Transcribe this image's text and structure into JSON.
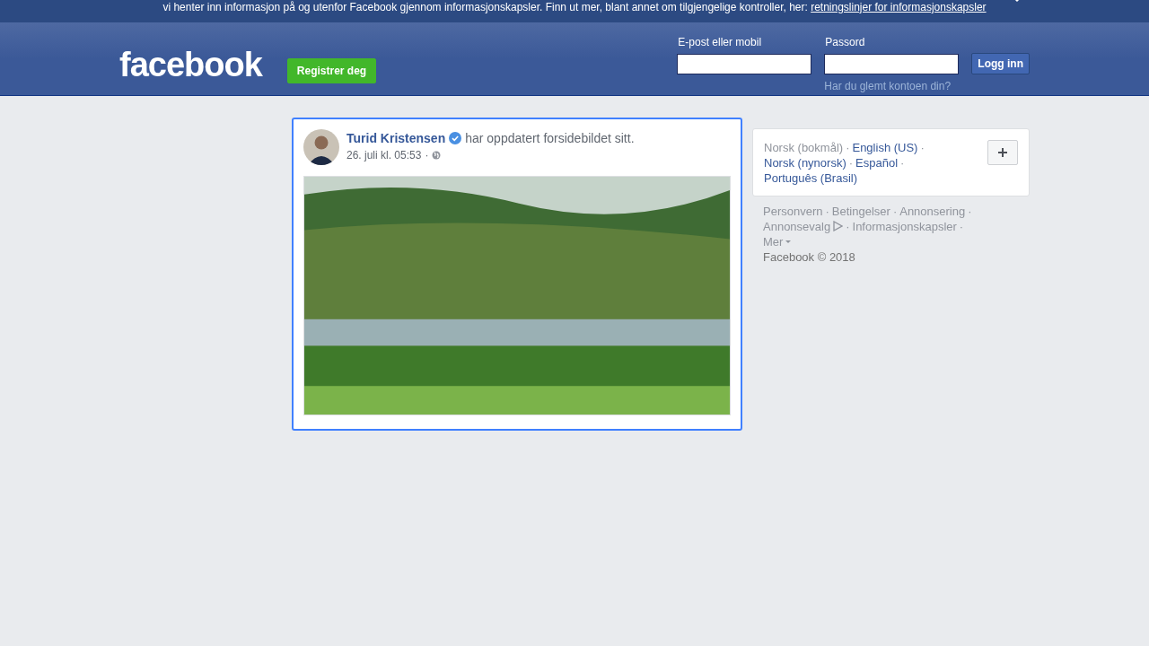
{
  "cookie_banner": {
    "text": "vi henter inn informasjon på og utenfor Facebook gjennom informasjonskapsler. Finn ut mer, blant annet om tilgjengelige kontroller, her:",
    "link": "retningslinjer for informasjonskapsler"
  },
  "header": {
    "logo": "facebook",
    "register_button": "Registrer deg",
    "email_label": "E-post eller mobil",
    "password_label": "Passord",
    "login_button": "Logg inn",
    "forgot_link": "Har du glemt kontoen din?"
  },
  "post": {
    "author": "Turid Kristensen",
    "verified": true,
    "action": "har oppdatert forsidebildet sitt.",
    "time": "26. juli kl. 05:53",
    "separator": "·"
  },
  "languages": [
    {
      "label": "Norsk (bokmål)",
      "selected": true,
      "sep": "·"
    },
    {
      "label": "English (US)",
      "selected": false,
      "sep": "·"
    },
    {
      "label": "Norsk (nynorsk)",
      "selected": false,
      "sep": "·"
    },
    {
      "label": "Español",
      "selected": false,
      "sep": "·"
    },
    {
      "label": "Português (Brasil)",
      "selected": false
    }
  ],
  "footer_links": [
    {
      "label": "Personvern",
      "sep": "·",
      "kind": "link"
    },
    {
      "label": "Betingelser",
      "sep": "·",
      "kind": "link"
    },
    {
      "label": "Annonsering",
      "sep": "·",
      "kind": "link"
    },
    {
      "label": "Annonsevalg",
      "sep": "·",
      "kind": "adchoices"
    },
    {
      "label": "Informasjonskapsler",
      "sep": "·",
      "kind": "link"
    },
    {
      "label": "Mer",
      "kind": "dropdown"
    }
  ],
  "copyright": "Facebook © 2018"
}
